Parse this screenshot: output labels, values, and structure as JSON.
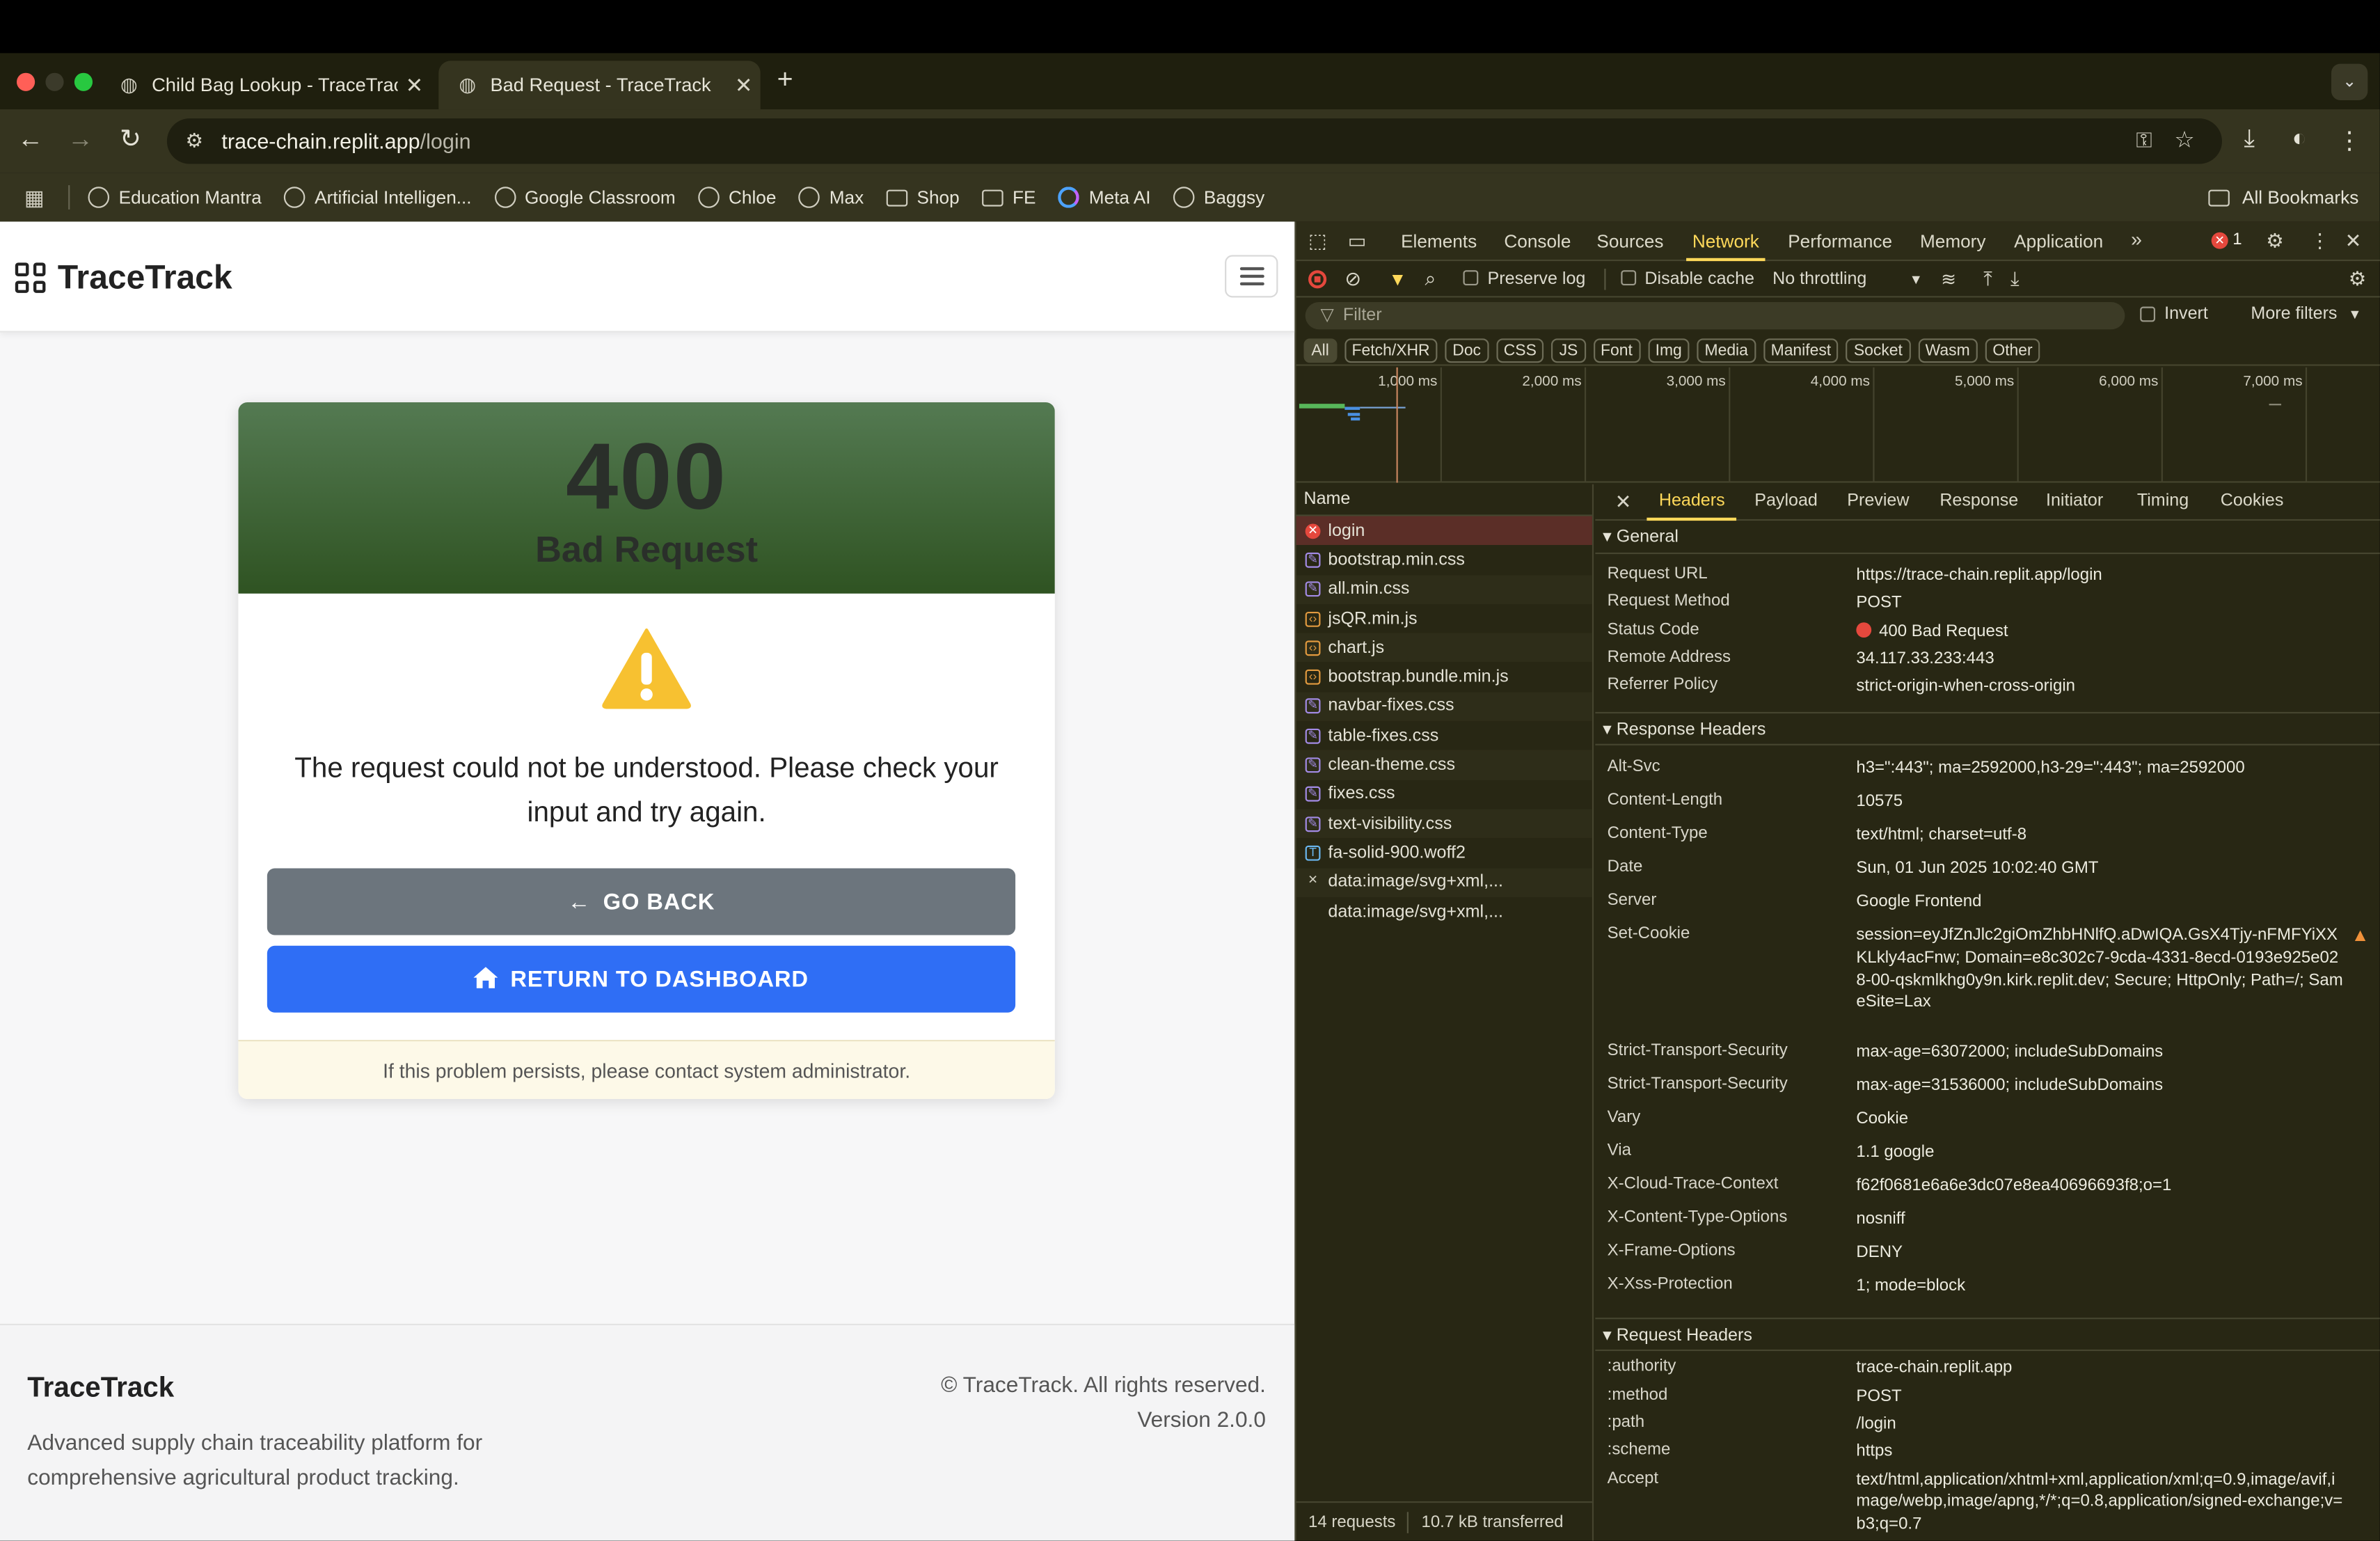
{
  "browser": {
    "tabs": [
      {
        "title": "Child Bag Lookup - TraceTrac",
        "active": false
      },
      {
        "title": "Bad Request - TraceTrack",
        "active": true
      }
    ],
    "url_host": "trace-chain.replit.app",
    "url_path": "/login",
    "bookmarks": [
      "Education Mantra",
      "Artificial Intelligen...",
      "Google Classroom",
      "Chloe",
      "Max",
      "Shop",
      "FE",
      "Meta AI",
      "Baggsy"
    ],
    "all_bookmarks": "All Bookmarks"
  },
  "page": {
    "brand": "TraceTrack",
    "error_code": "400",
    "error_title": "Bad Request",
    "message": "The request could not be understood. Please check your input and try again.",
    "back_label": "GO BACK",
    "dashboard_label": "RETURN TO DASHBOARD",
    "footnote": "If this problem persists, please contact system administrator.",
    "footer_title": "TraceTrack",
    "footer_desc": "Advanced supply chain traceability platform for comprehensive agricultural product tracking.",
    "footer_copy": "© TraceTrack. All rights reserved.",
    "footer_version": "Version 2.0.0"
  },
  "devtools": {
    "tabs": [
      "Elements",
      "Console",
      "Sources",
      "Network",
      "Performance",
      "Memory",
      "Application"
    ],
    "active_tab": "Network",
    "error_count": "1",
    "preserve_log": "Preserve log",
    "disable_cache": "Disable cache",
    "throttling": "No throttling",
    "filter_placeholder": "Filter",
    "invert": "Invert",
    "more_filters": "More filters",
    "type_filters": [
      "All",
      "Fetch/XHR",
      "Doc",
      "CSS",
      "JS",
      "Font",
      "Img",
      "Media",
      "Manifest",
      "Socket",
      "Wasm",
      "Other"
    ],
    "timeline_labels": [
      "1,000 ms",
      "2,000 ms",
      "3,000 ms",
      "4,000 ms",
      "5,000 ms",
      "6,000 ms",
      "7,000 ms"
    ],
    "name_header": "Name",
    "requests": [
      {
        "name": "login",
        "type": "err"
      },
      {
        "name": "bootstrap.min.css",
        "type": "css"
      },
      {
        "name": "all.min.css",
        "type": "css"
      },
      {
        "name": "jsQR.min.js",
        "type": "js"
      },
      {
        "name": "chart.js",
        "type": "js"
      },
      {
        "name": "bootstrap.bundle.min.js",
        "type": "js"
      },
      {
        "name": "navbar-fixes.css",
        "type": "css"
      },
      {
        "name": "table-fixes.css",
        "type": "css"
      },
      {
        "name": "clean-theme.css",
        "type": "css"
      },
      {
        "name": "fixes.css",
        "type": "css"
      },
      {
        "name": "text-visibility.css",
        "type": "css"
      },
      {
        "name": "fa-solid-900.woff2",
        "type": "font"
      },
      {
        "name": "data:image/svg+xml,...",
        "type": "none"
      },
      {
        "name": "data:image/svg+xml,...",
        "type": "blank"
      }
    ],
    "summary_requests": "14 requests",
    "summary_transferred": "10.7 kB transferred",
    "detail_tabs": [
      "Headers",
      "Payload",
      "Preview",
      "Response",
      "Initiator",
      "Timing",
      "Cookies"
    ],
    "general_title": "General",
    "general": [
      {
        "k": "Request URL",
        "v": "https://trace-chain.replit.app/login"
      },
      {
        "k": "Request Method",
        "v": "POST"
      },
      {
        "k": "Status Code",
        "v": "400 Bad Request"
      },
      {
        "k": "Remote Address",
        "v": "34.117.33.233:443"
      },
      {
        "k": "Referrer Policy",
        "v": "strict-origin-when-cross-origin"
      }
    ],
    "response_title": "Response Headers",
    "response": [
      {
        "k": "Alt-Svc",
        "v": "h3=\":443\"; ma=2592000,h3-29=\":443\"; ma=2592000"
      },
      {
        "k": "Content-Length",
        "v": "10575"
      },
      {
        "k": "Content-Type",
        "v": "text/html; charset=utf-8"
      },
      {
        "k": "Date",
        "v": "Sun, 01 Jun 2025 10:02:40 GMT"
      },
      {
        "k": "Server",
        "v": "Google Frontend"
      },
      {
        "k": "Set-Cookie",
        "v": "session=eyJfZnJlc2giOmZhbHNlfQ.aDwIQA.GsX4Tjy-nFMFYiXXKLkly4acFnw; Domain=e8c302c7-9cda-4331-8ecd-0193e925e028-00-qskmlkhg0y9n.kirk.replit.dev; Secure; HttpOnly; Path=/; SameSite=Lax"
      },
      {
        "k": "Strict-Transport-Security",
        "v": "max-age=63072000; includeSubDomains"
      },
      {
        "k": "Strict-Transport-Security",
        "v": "max-age=31536000; includeSubDomains"
      },
      {
        "k": "Vary",
        "v": "Cookie"
      },
      {
        "k": "Via",
        "v": "1.1 google"
      },
      {
        "k": "X-Cloud-Trace-Context",
        "v": "f62f0681e6a6e3dc07e8ea40696693f8;o=1"
      },
      {
        "k": "X-Content-Type-Options",
        "v": "nosniff"
      },
      {
        "k": "X-Frame-Options",
        "v": "DENY"
      },
      {
        "k": "X-Xss-Protection",
        "v": "1; mode=block"
      }
    ],
    "request_title": "Request Headers",
    "request": [
      {
        "k": ":authority",
        "v": "trace-chain.replit.app"
      },
      {
        "k": ":method",
        "v": "POST"
      },
      {
        "k": ":path",
        "v": "/login"
      },
      {
        "k": ":scheme",
        "v": "https"
      },
      {
        "k": "Accept",
        "v": "text/html,application/xhtml+xml,application/xml;q=0.9,image/avif,image/webp,image/apng,*/*;q=0.8,application/signed-exchange;v=b3;q=0.7"
      }
    ]
  },
  "colors": {
    "header_green": "#3d6335",
    "btn_secondary": "#6c757d",
    "btn_primary": "#2f6ef5",
    "warn_yellow": "#f7c131",
    "devtools_accent": "#ffd95a",
    "status_error": "#e5483d"
  }
}
